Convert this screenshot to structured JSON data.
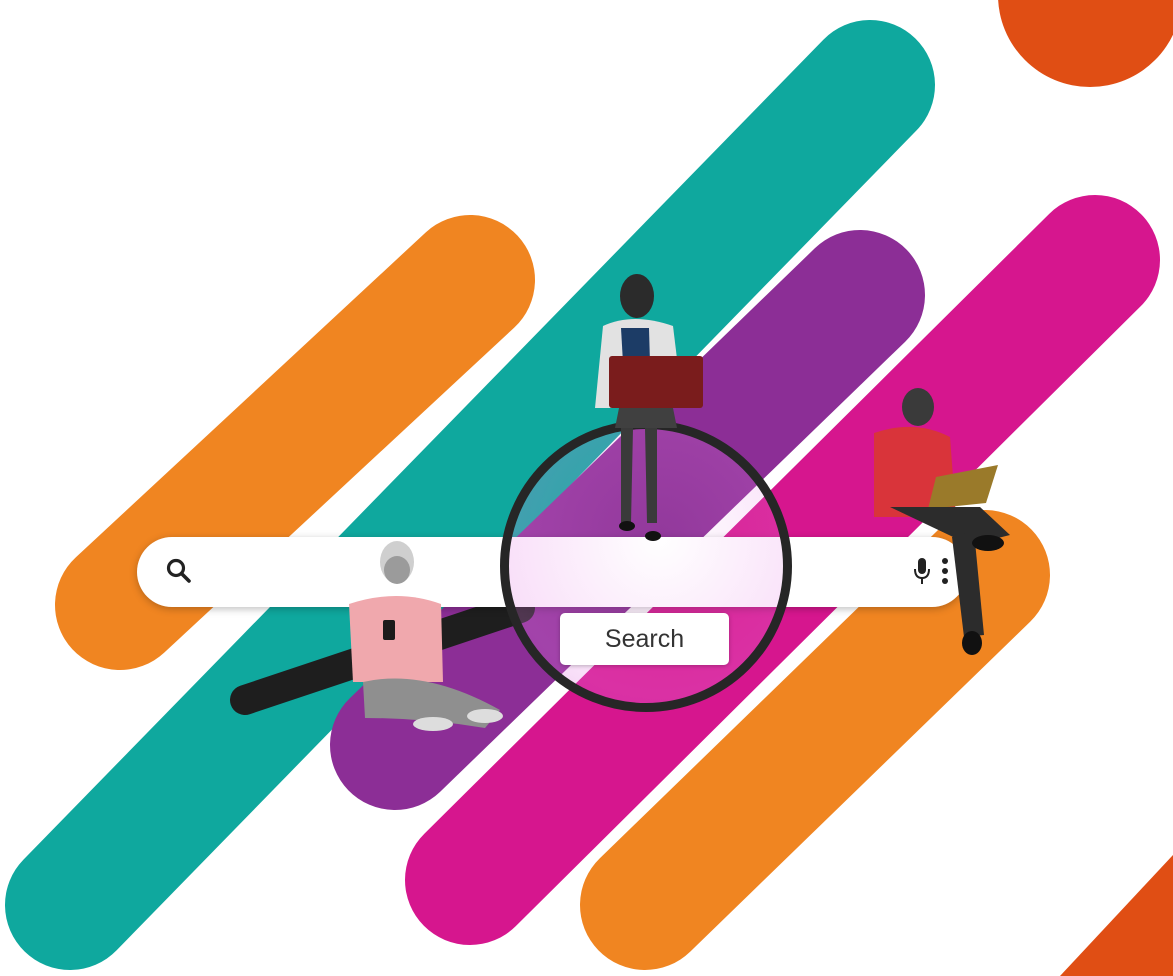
{
  "search": {
    "button_label": "Search",
    "input_value": "",
    "icons": {
      "left": "search-icon",
      "right_1": "microphone-icon",
      "right_2": "more-vertical-icon"
    }
  },
  "colors": {
    "orange": "#F08521",
    "teal": "#0FA89E",
    "purple": "#8C2E96",
    "magenta": "#D6168E",
    "corner_orange": "#E04E14",
    "search_bar": "#FFFFFF",
    "magnifier_frame": "#262626"
  }
}
